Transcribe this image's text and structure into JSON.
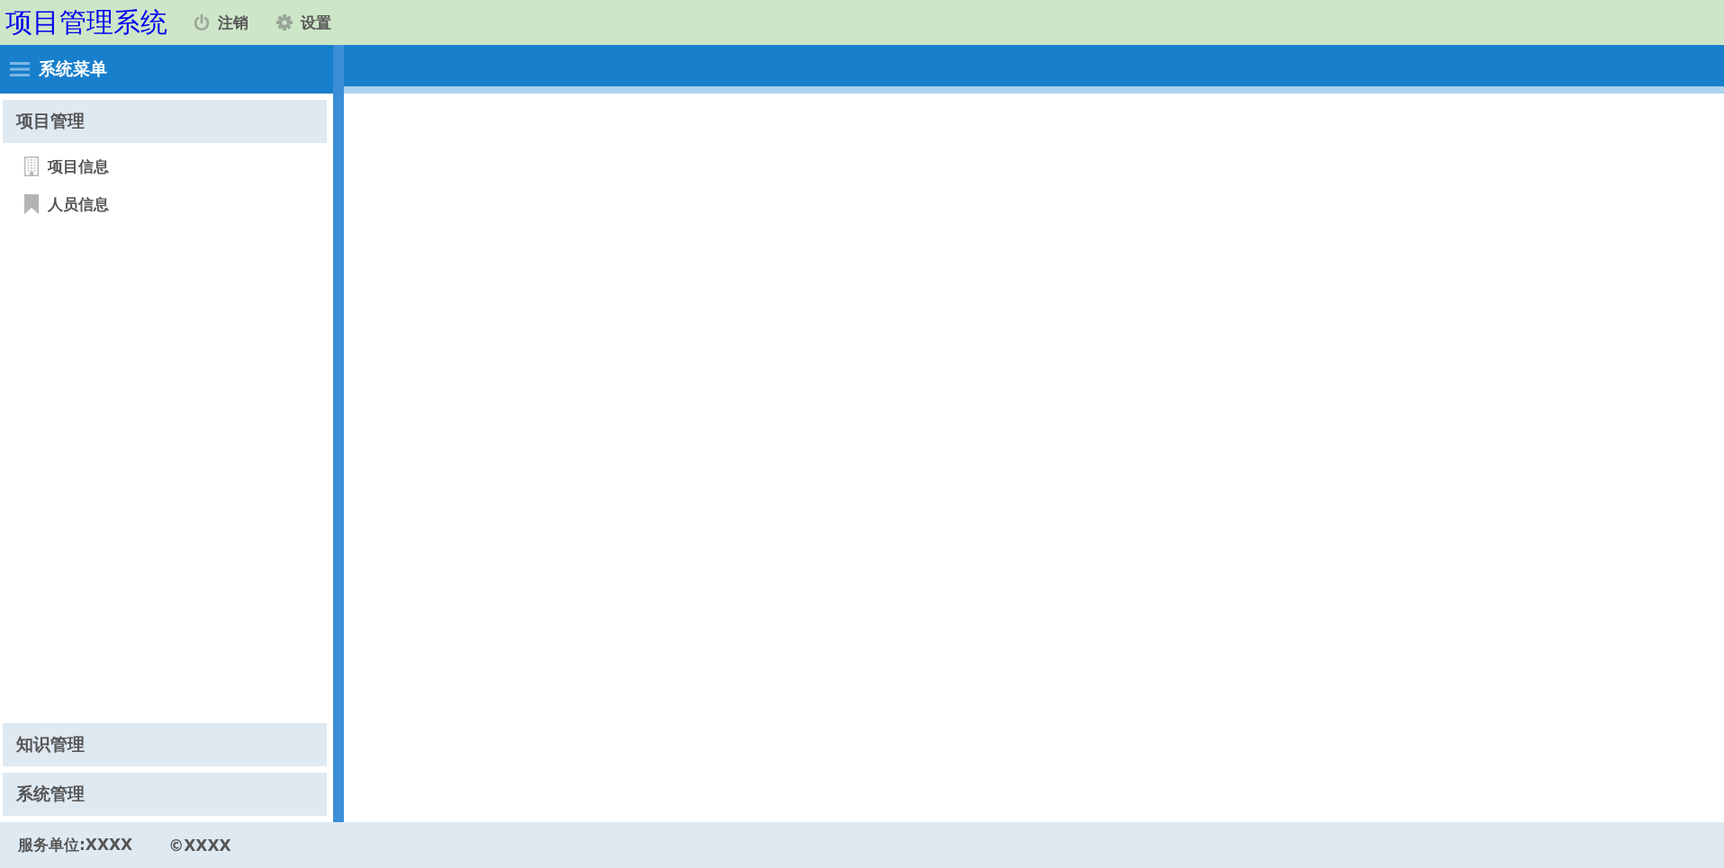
{
  "header": {
    "title": "项目管理系统",
    "actions": [
      {
        "kind": "power",
        "label": "注销"
      },
      {
        "kind": "gear",
        "label": "设置"
      }
    ]
  },
  "sidebar": {
    "title": "系统菜单",
    "panels": [
      {
        "title": "项目管理",
        "items": [
          {
            "kind": "building",
            "label": "项目信息"
          },
          {
            "kind": "bookmark",
            "label": "人员信息"
          }
        ]
      },
      {
        "title": "知识管理"
      },
      {
        "title": "系统管理"
      }
    ]
  },
  "footer": {
    "texts": [
      "服务单位:XXXX",
      "©XXXX"
    ]
  }
}
